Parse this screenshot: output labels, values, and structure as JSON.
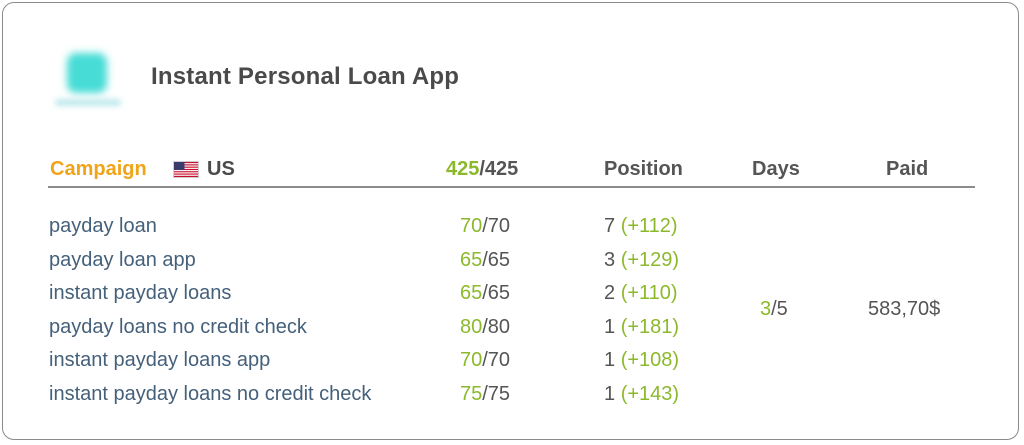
{
  "app": {
    "title": "Instant Personal Loan App",
    "icon": "app-icon-blurred",
    "icon_color": "#47dcd6"
  },
  "header": {
    "campaign_label": "Campaign",
    "country_flag": "us-flag-icon",
    "country": "US",
    "score_done": "425",
    "score_total": "/425",
    "position_label": "Position",
    "days_label": "Days",
    "paid_label": "Paid"
  },
  "colors": {
    "campaign": "#f0a418",
    "positive": "#8cb92c",
    "keyword": "#44607a",
    "text": "#555555"
  },
  "keywords": [
    {
      "keyword": "payday loan",
      "score_done": "70",
      "score_total": "/70",
      "position": "7",
      "change": "(+112)"
    },
    {
      "keyword": "payday loan app",
      "score_done": "65",
      "score_total": "/65",
      "position": "3",
      "change": "(+129)"
    },
    {
      "keyword": "instant payday loans",
      "score_done": "65",
      "score_total": "/65",
      "position": "2",
      "change": "(+110)"
    },
    {
      "keyword": "payday loans no credit check",
      "score_done": "80",
      "score_total": "/80",
      "position": "1",
      "change": "(+181)"
    },
    {
      "keyword": "instant payday loans app",
      "score_done": "70",
      "score_total": "/70",
      "position": "1",
      "change": "(+108)"
    },
    {
      "keyword": "instant payday loans no credit check",
      "score_done": "75",
      "score_total": "/75",
      "position": "1",
      "change": "(+143)"
    }
  ],
  "summary": {
    "days_done": "3",
    "days_total": "/5",
    "paid": "583,70$"
  }
}
